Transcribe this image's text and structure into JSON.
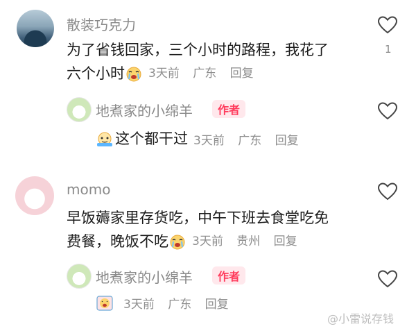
{
  "comments": [
    {
      "author": "散装巧克力",
      "text_line1": "为了省钱回家，三个小时的路程，我花了",
      "text_line2": "六个小时",
      "time": "3天前",
      "location": "广东",
      "reply_label": "回复",
      "like_count": "1",
      "reply": {
        "author": "地煮家的小绵羊",
        "badge": "作者",
        "text": "这个都干过",
        "time": "3天前",
        "location": "广东",
        "reply_label": "回复"
      }
    },
    {
      "author": "momo",
      "text_line1": "早饭薅家里存货吃，中午下班去食堂吃免",
      "text_line2": "费餐，晚饭不吃",
      "time": "3天前",
      "location": "贵州",
      "reply_label": "回复",
      "like_count": "",
      "reply": {
        "author": "地煮家的小绵羊",
        "badge": "作者",
        "text": "",
        "time": "3天前",
        "location": "广东",
        "reply_label": "回复"
      }
    }
  ],
  "watermark": "@小雷说存钱",
  "icons": {
    "like": "heart-outline-icon",
    "emoji_cry": "crying-face-emoji-icon",
    "emoji_sweat": "sweating-face-emoji-icon"
  },
  "colors": {
    "badge_text": "#ff3b5c",
    "badge_bg": "#ffe8ec",
    "meta": "#8e8e8e"
  }
}
